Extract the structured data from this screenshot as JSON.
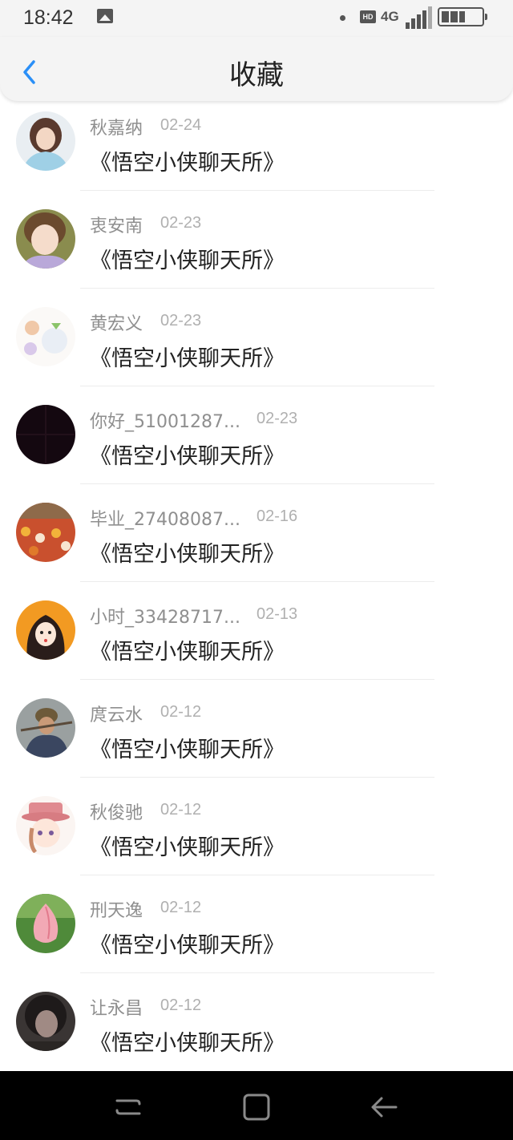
{
  "status_bar": {
    "time": "18:42",
    "hd_badge": "HD",
    "network": "4G",
    "icons": [
      "image-icon",
      "dot-icon",
      "signal-icon",
      "battery-icon"
    ],
    "battery_level": 0.6
  },
  "header": {
    "title": "收藏",
    "back_icon": "chevron-left-icon",
    "accent_color": "#2a8ff7"
  },
  "items": [
    {
      "name": "秋嘉纳",
      "date": "02-24",
      "title": "《悟空小侠聊天所》"
    },
    {
      "name": "衷安南",
      "date": "02-23",
      "title": "《悟空小侠聊天所》"
    },
    {
      "name": "黄宏义",
      "date": "02-23",
      "title": "《悟空小侠聊天所》"
    },
    {
      "name": "你好_51001287...",
      "date": "02-23",
      "title": "《悟空小侠聊天所》"
    },
    {
      "name": "毕业_27408087...",
      "date": "02-16",
      "title": "《悟空小侠聊天所》"
    },
    {
      "name": "小时_33428717...",
      "date": "02-13",
      "title": "《悟空小侠聊天所》"
    },
    {
      "name": "庹云水",
      "date": "02-12",
      "title": "《悟空小侠聊天所》"
    },
    {
      "name": "秋俊驰",
      "date": "02-12",
      "title": "《悟空小侠聊天所》"
    },
    {
      "name": "刑天逸",
      "date": "02-12",
      "title": "《悟空小侠聊天所》"
    },
    {
      "name": "让永昌",
      "date": "02-12",
      "title": "《悟空小侠聊天所》"
    }
  ],
  "nav_bar": {
    "icons": [
      "recents-icon",
      "home-icon",
      "back-arrow-icon"
    ]
  }
}
